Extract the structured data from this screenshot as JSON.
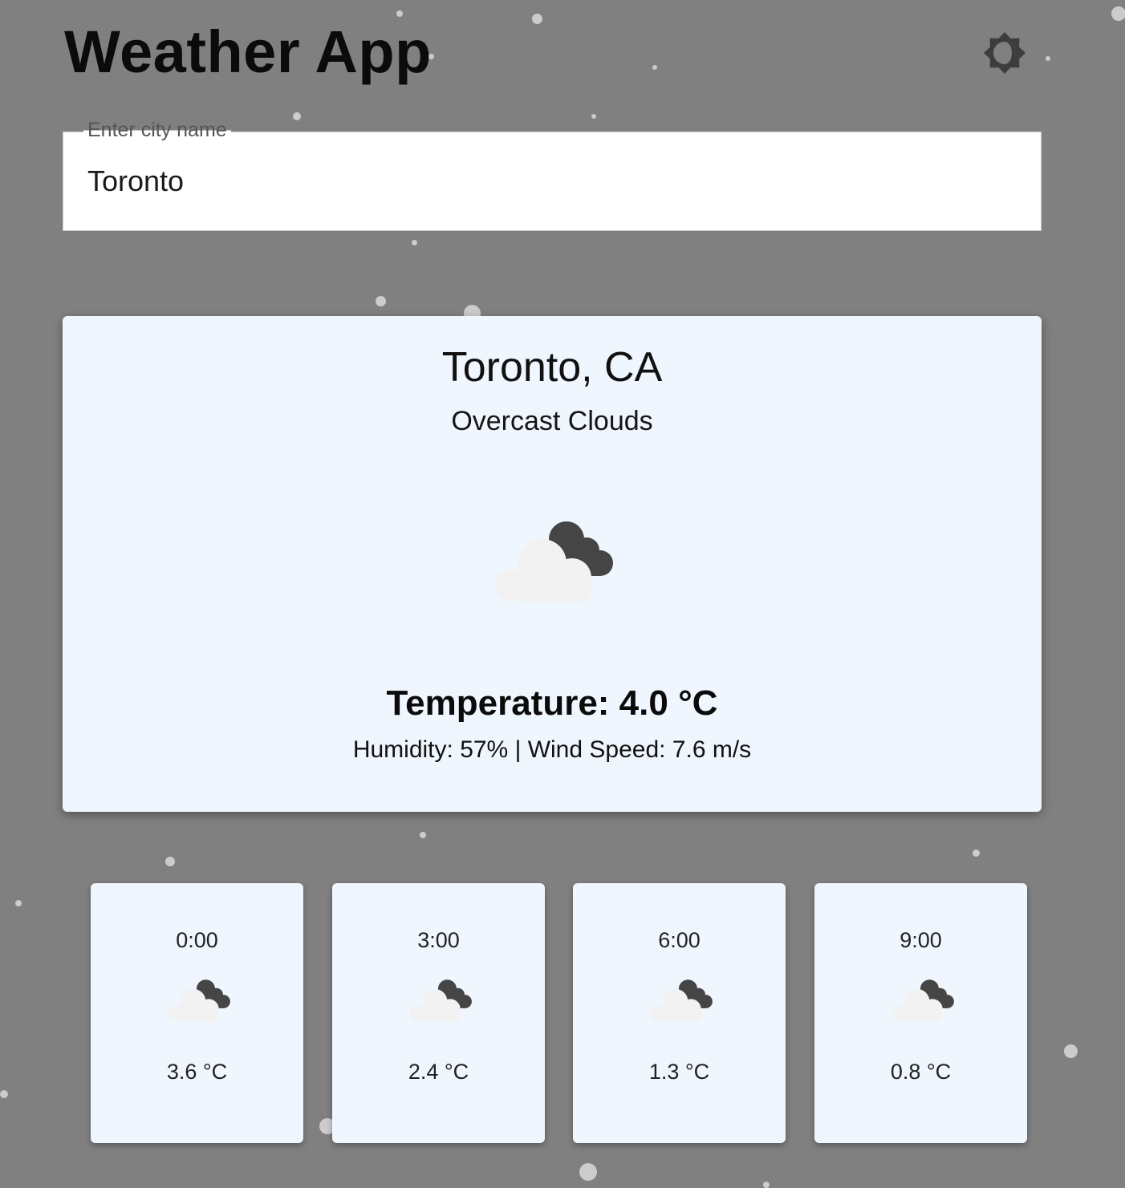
{
  "header": {
    "title": "Weather App",
    "theme_toggle_icon": "brightness-icon"
  },
  "search": {
    "label": "Enter city name",
    "value": "Toronto"
  },
  "current": {
    "location": "Toronto, CA",
    "condition": "Overcast Clouds",
    "icon": "overcast-clouds-icon",
    "temperature": "Temperature: 4.0 °C",
    "details": "Humidity: 57% | Wind Speed: 7.6 m/s"
  },
  "forecast": [
    {
      "time": "0:00",
      "icon": "overcast-clouds-icon",
      "temp": "3.6 °C"
    },
    {
      "time": "3:00",
      "icon": "overcast-clouds-icon",
      "temp": "2.4 °C"
    },
    {
      "time": "6:00",
      "icon": "overcast-clouds-icon",
      "temp": "1.3 °C"
    },
    {
      "time": "9:00",
      "icon": "overcast-clouds-icon",
      "temp": "0.8 °C"
    }
  ],
  "colors": {
    "background": "#808080",
    "card": "#f0f6fe",
    "cloud_light": "#f2f2f2",
    "cloud_dark": "#444444"
  }
}
